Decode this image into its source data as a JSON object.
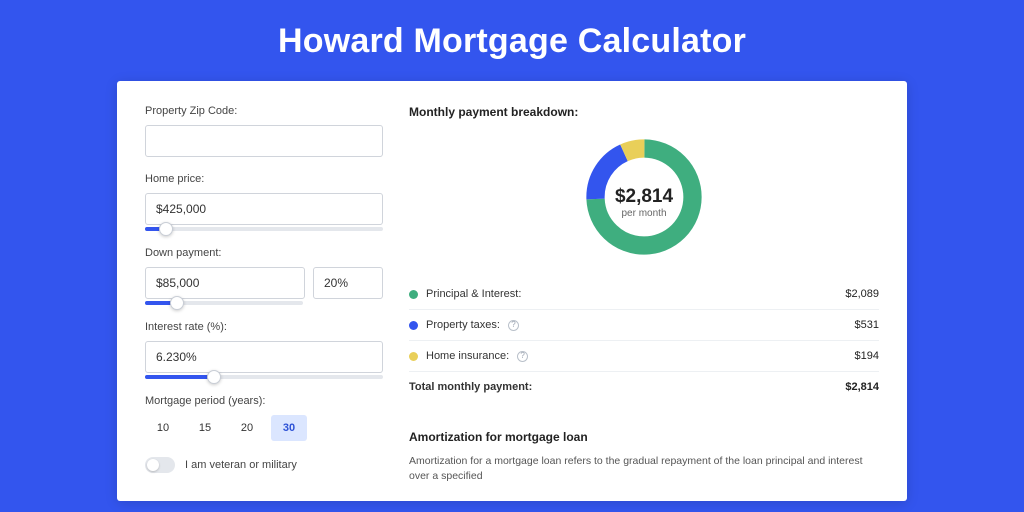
{
  "title": "Howard Mortgage Calculator",
  "form": {
    "zip_label": "Property Zip Code:",
    "zip_value": "",
    "home_price_label": "Home price:",
    "home_price_value": "$425,000",
    "home_price_slider_pct": 9,
    "down_payment_label": "Down payment:",
    "down_payment_value": "$85,000",
    "down_payment_pct": "20%",
    "down_payment_slider_pct": 20,
    "interest_label": "Interest rate (%):",
    "interest_value": "6.230%",
    "interest_slider_pct": 29,
    "period_label": "Mortgage period (years):",
    "periods": [
      "10",
      "15",
      "20",
      "30"
    ],
    "period_selected": "30",
    "veteran_label": "I am veteran or military"
  },
  "breakdown": {
    "heading": "Monthly payment breakdown:",
    "center_value": "$2,814",
    "center_sub": "per month",
    "rows": [
      {
        "color": "green",
        "label": "Principal & Interest:",
        "value": "$2,089",
        "info": false
      },
      {
        "color": "blue",
        "label": "Property taxes:",
        "value": "$531",
        "info": true
      },
      {
        "color": "yellow",
        "label": "Home insurance:",
        "value": "$194",
        "info": true
      }
    ],
    "total_label": "Total monthly payment:",
    "total_value": "$2,814"
  },
  "amortization": {
    "heading": "Amortization for mortgage loan",
    "body": "Amortization for a mortgage loan refers to the gradual repayment of the loan principal and interest over a specified"
  },
  "chart_data": {
    "type": "pie",
    "title": "Monthly payment breakdown",
    "series": [
      {
        "name": "Principal & Interest",
        "value": 2089,
        "color": "#3fae7f"
      },
      {
        "name": "Property taxes",
        "value": 531,
        "color": "#3355ee"
      },
      {
        "name": "Home insurance",
        "value": 194,
        "color": "#e9cf59"
      }
    ],
    "total": 2814,
    "unit": "USD/month"
  }
}
